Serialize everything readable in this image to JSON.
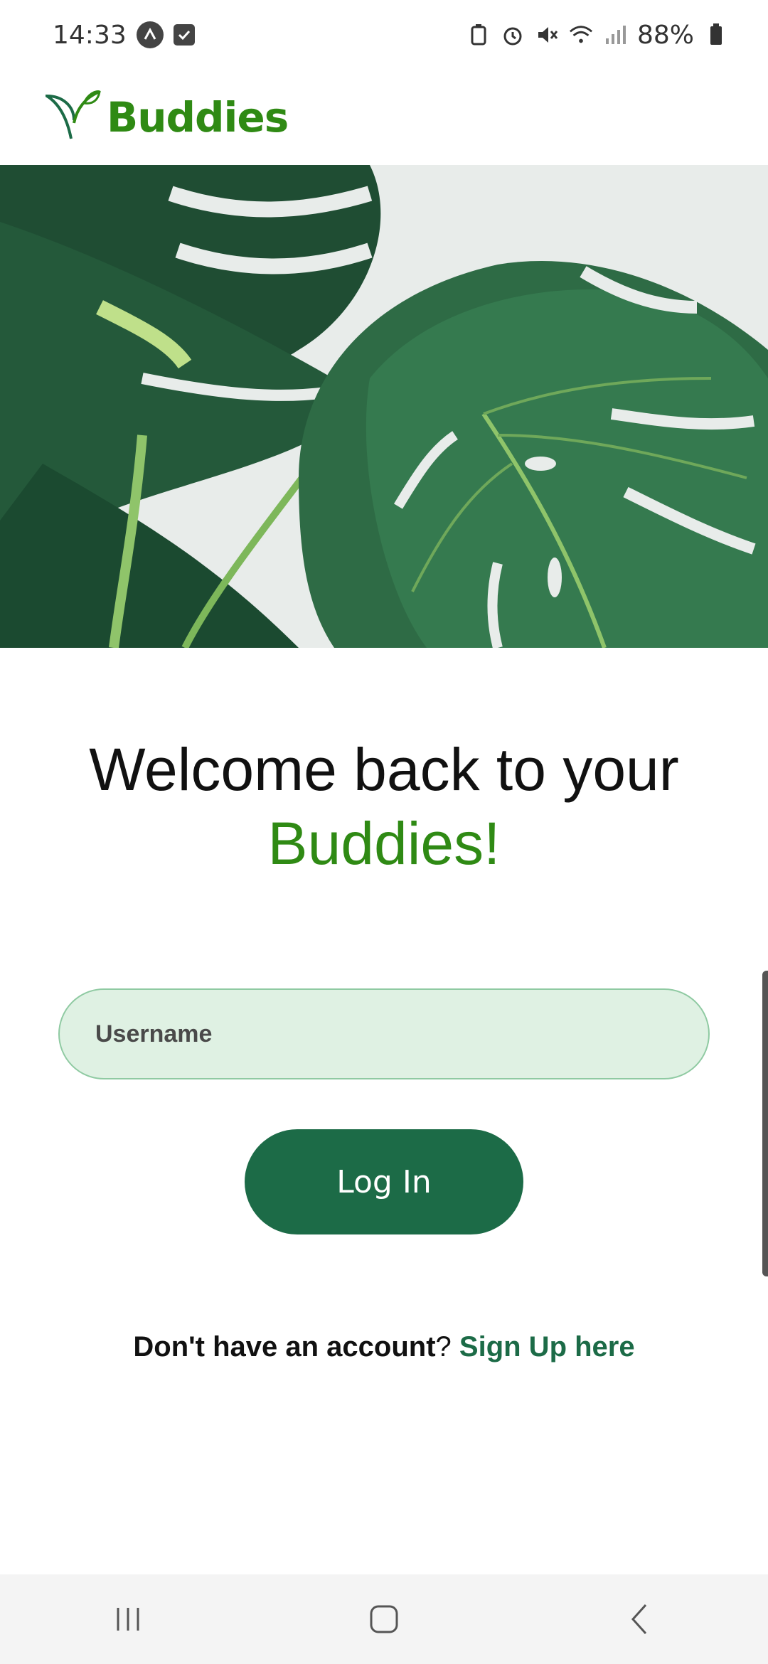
{
  "status_bar": {
    "time": "14:33",
    "battery": "88%"
  },
  "header": {
    "logo_text": "Buddies"
  },
  "welcome": {
    "line1": "Welcome back to your",
    "line2": "Buddies!"
  },
  "login_form": {
    "username_placeholder": "Username",
    "login_label": "Log In"
  },
  "signup": {
    "prompt": "Don't have an account",
    "question_mark": "?",
    "link_label": "Sign Up here"
  },
  "colors": {
    "brand_green": "#2f8a14",
    "button_green": "#1c6b47",
    "input_bg": "#dff1e3"
  },
  "nav": {
    "icons": [
      "recent-apps-icon",
      "home-icon",
      "back-icon"
    ]
  }
}
